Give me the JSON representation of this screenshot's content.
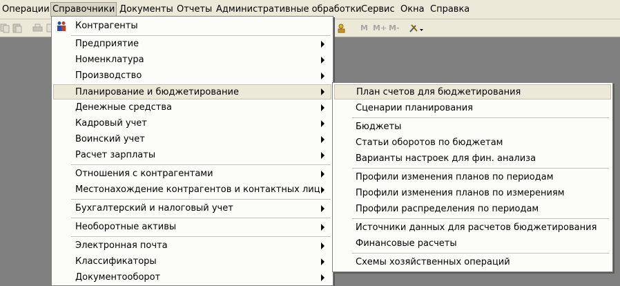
{
  "menubar": {
    "items": [
      {
        "label": "Операции"
      },
      {
        "label": "Справочники"
      },
      {
        "label": "Документы"
      },
      {
        "label": "Отчеты"
      },
      {
        "label": "Административные обработки"
      },
      {
        "label": "Сервис"
      },
      {
        "label": "Окна"
      },
      {
        "label": "Справка"
      }
    ]
  },
  "toolbar": {
    "m_label": "М",
    "m_plus_label": "М+",
    "m_minus_label": "М-"
  },
  "catalog_menu": {
    "items": [
      {
        "label": "Контрагенты",
        "icon": "people-icon"
      },
      {
        "label": "Предприятие"
      },
      {
        "label": "Номенклатура"
      },
      {
        "label": "Производство"
      },
      {
        "label": "Планирование и бюджетирование"
      },
      {
        "label": "Денежные средства"
      },
      {
        "label": "Кадровый учет"
      },
      {
        "label": "Воинский учет"
      },
      {
        "label": "Расчет зарплаты"
      },
      {
        "label": "Отношения с контрагентами"
      },
      {
        "label": "Местонахождение контрагентов и контактных лиц"
      },
      {
        "label": "Бухгалтерский и налоговый учет"
      },
      {
        "label": "Необоротные активы"
      },
      {
        "label": "Электронная почта"
      },
      {
        "label": "Классификаторы"
      },
      {
        "label": "Документооборот"
      }
    ]
  },
  "planning_submenu": {
    "items": [
      {
        "label": "План счетов для бюджетирования"
      },
      {
        "label": "Сценарии планирования"
      },
      {
        "label": "Бюджеты"
      },
      {
        "label": "Статьи оборотов по бюджетам"
      },
      {
        "label": "Варианты настроек для фин. анализа"
      },
      {
        "label": "Профили изменения планов по периодам"
      },
      {
        "label": "Профили изменения планов по измерениям"
      },
      {
        "label": "Профили распределения по периодам"
      },
      {
        "label": "Источники данных для расчетов бюджетирования"
      },
      {
        "label": "Финансовые расчеты"
      },
      {
        "label": "Схемы хозяйственных операций"
      }
    ]
  }
}
